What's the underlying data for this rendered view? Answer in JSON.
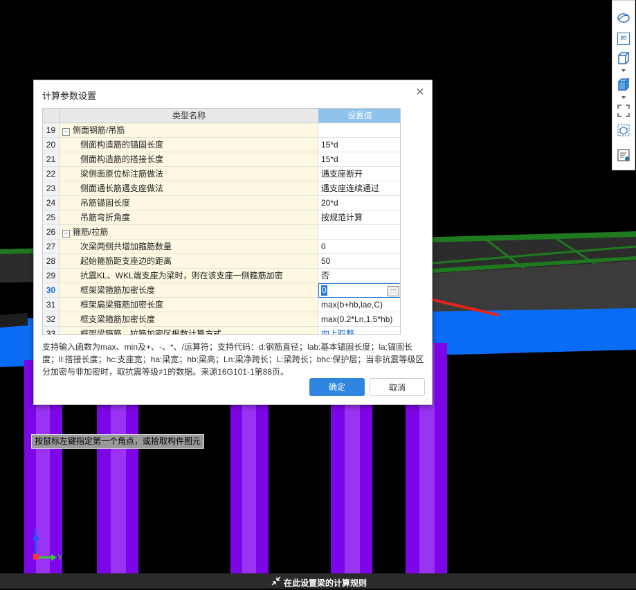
{
  "dialog": {
    "title": "计算参数设置",
    "columns": {
      "name": "类型名称",
      "value": "设置值"
    },
    "rows": [
      {
        "num": "19",
        "name": "侧面钢筋/吊筋",
        "value": "",
        "group": true
      },
      {
        "num": "20",
        "name": "侧面构造筋的锚固长度",
        "value": "15*d"
      },
      {
        "num": "21",
        "name": "侧面构造筋的搭接长度",
        "value": "15*d"
      },
      {
        "num": "22",
        "name": "梁侧面原位标注筋做法",
        "value": "遇支座断开"
      },
      {
        "num": "23",
        "name": "侧面通长筋遇支座做法",
        "value": "遇支座连续通过"
      },
      {
        "num": "24",
        "name": "吊筋锚固长度",
        "value": "20*d"
      },
      {
        "num": "25",
        "name": "吊筋弯折角度",
        "value": "按规范计算"
      },
      {
        "num": "26",
        "name": "箍筋/拉筋",
        "value": "",
        "group": true
      },
      {
        "num": "27",
        "name": "次梁两侧共增加箍筋数量",
        "value": "0"
      },
      {
        "num": "28",
        "name": "起始箍筋距支座边的距离",
        "value": "50"
      },
      {
        "num": "29",
        "name": "抗震KL、WKL端支座为梁时，则在该支座一侧箍筋加密",
        "value": "否"
      },
      {
        "num": "30",
        "name": "框架梁箍筋加密长度",
        "value": "0",
        "selected": true
      },
      {
        "num": "31",
        "name": "框架扁梁箍筋加密长度",
        "value": "max(b+hb,lae,C)"
      },
      {
        "num": "32",
        "name": "框支梁箍筋加密长度",
        "value": "max(0.2*Ln,1.5*hb)"
      },
      {
        "num": "33",
        "name": "框架梁箍筋、拉筋加密区根数计算方式",
        "value": "向上取整"
      }
    ],
    "description": "支持输入函数为max、min及+、-、*、/运算符；支持代码：d:钢筋直径；lab:基本锚固长度；la:锚固长度；ll:搭接长度；hc:支座宽；ha:梁宽；hb:梁高；Ln:梁净跨长；L:梁跨长；bhc:保护层；当非抗震等级区分加密与非加密时，取抗震等级≠1的数据。来源16G101-1第88页。",
    "ok_label": "确定",
    "cancel_label": "取消"
  },
  "tooltip": "按鼠标左键指定第一个角点，或拾取构件图元",
  "bottom_label": "在此设置梁的计算规则",
  "toolbar": {
    "icons": [
      "orbit-icon",
      "view-2d-icon",
      "view-3d-box-icon",
      "view-3d-solid-icon",
      "fullscreen-icon",
      "select-box-icon",
      "list-settings-icon"
    ],
    "label_2d": "2D"
  },
  "axes": {
    "z": "Z",
    "y": "Y"
  },
  "colors": {
    "beam_blue": "#0a6cf5",
    "column_purple": "#7d06e8",
    "slab_green": "#1f6b1f",
    "accent": "#2f86e0",
    "arrow_red": "#e8231c"
  }
}
